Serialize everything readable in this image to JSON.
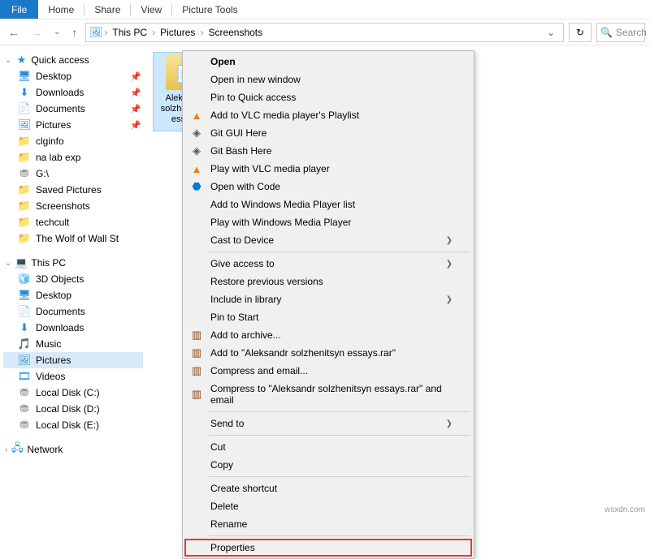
{
  "ribbon": {
    "file": "File",
    "home": "Home",
    "share": "Share",
    "view": "View",
    "picture_tools": "Picture Tools"
  },
  "nav": {
    "this_pc": "This PC",
    "pictures": "Pictures",
    "screenshots": "Screenshots",
    "search_placeholder": "Search"
  },
  "sidebar": {
    "quick_access": "Quick access",
    "quick_items": [
      {
        "label": "Desktop",
        "icon": "desktop",
        "pinned": true
      },
      {
        "label": "Downloads",
        "icon": "download",
        "pinned": true
      },
      {
        "label": "Documents",
        "icon": "doc",
        "pinned": true
      },
      {
        "label": "Pictures",
        "icon": "pic",
        "pinned": true
      },
      {
        "label": "clginfo",
        "icon": "folder-y",
        "pinned": false
      },
      {
        "label": "na lab exp",
        "icon": "folder-y",
        "pinned": false
      },
      {
        "label": "G:\\",
        "icon": "drive",
        "pinned": false
      },
      {
        "label": "Saved Pictures",
        "icon": "folder-y",
        "pinned": false
      },
      {
        "label": "Screenshots",
        "icon": "folder-y",
        "pinned": false
      },
      {
        "label": "techcult",
        "icon": "folder-y",
        "pinned": false
      },
      {
        "label": "The Wolf of Wall St",
        "icon": "folder-y",
        "pinned": false
      }
    ],
    "this_pc": "This PC",
    "pc_items": [
      {
        "label": "3D Objects",
        "icon": "3d"
      },
      {
        "label": "Desktop",
        "icon": "desktop"
      },
      {
        "label": "Documents",
        "icon": "doc"
      },
      {
        "label": "Downloads",
        "icon": "download"
      },
      {
        "label": "Music",
        "icon": "music"
      },
      {
        "label": "Pictures",
        "icon": "pic",
        "selected": true
      },
      {
        "label": "Videos",
        "icon": "video"
      },
      {
        "label": "Local Disk (C:)",
        "icon": "disk"
      },
      {
        "label": "Local Disk (D:)",
        "icon": "disk"
      },
      {
        "label": "Local Disk (E:)",
        "icon": "disk"
      }
    ],
    "network": "Network"
  },
  "content": {
    "folder_name": "Aleksandr solzhenitsyn essays"
  },
  "context_menu": {
    "open": "Open",
    "open_new_window": "Open in new window",
    "pin_quick": "Pin to Quick access",
    "vlc_playlist": "Add to VLC media player's Playlist",
    "git_gui": "Git GUI Here",
    "git_bash": "Git Bash Here",
    "vlc_play": "Play with VLC media player",
    "open_code": "Open with Code",
    "wmp_add": "Add to Windows Media Player list",
    "wmp_play": "Play with Windows Media Player",
    "cast": "Cast to Device",
    "give_access": "Give access to",
    "restore": "Restore previous versions",
    "include_library": "Include in library",
    "pin_start": "Pin to Start",
    "add_archive": "Add to archive...",
    "add_rar": "Add to \"Aleksandr solzhenitsyn essays.rar\"",
    "compress_email": "Compress and email...",
    "compress_rar_email": "Compress to \"Aleksandr solzhenitsyn essays.rar\" and email",
    "send_to": "Send to",
    "cut": "Cut",
    "copy": "Copy",
    "create_shortcut": "Create shortcut",
    "delete": "Delete",
    "rename": "Rename",
    "properties": "Properties"
  },
  "watermark": "wsxdn.com"
}
